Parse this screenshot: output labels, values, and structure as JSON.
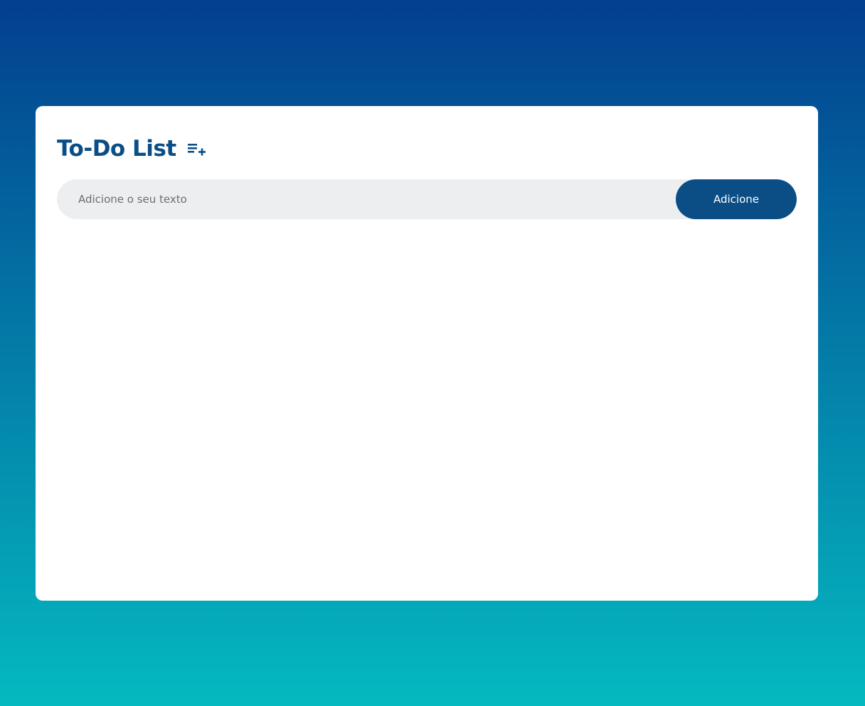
{
  "app": {
    "title": "To-Do List",
    "title_icon": "playlist-add-icon"
  },
  "form": {
    "input_placeholder": "Adicione o seu texto",
    "input_value": "",
    "add_button_label": "Adicione"
  },
  "tasks": [],
  "colors": {
    "background_top": "#033f8f",
    "background_bottom": "#04b9c0",
    "accent": "#0a4e85",
    "card": "#ffffff",
    "input_background": "#edeef0"
  }
}
